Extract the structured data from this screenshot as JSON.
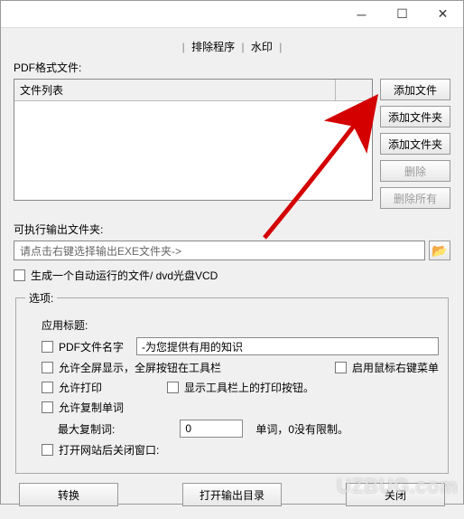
{
  "tabs": {
    "t1": "排除程序",
    "t2": "水印"
  },
  "labels": {
    "pdf_files": "PDF格式文件:",
    "file_list_col": "文件列表",
    "output_folder": "可执行输出文件夹:",
    "output_placeholder": "请点击右键选择输出EXE文件夹->",
    "generate_autorun": "生成一个自动运行的文件/  dvd光盘VCD",
    "options_legend": "选项:",
    "app_title_label": "应用标题:",
    "pdf_name": "PDF文件名字",
    "pdf_name_value": "-为您提供有用的知识",
    "allow_fullscreen": "允许全屏显示，全屏按钮在工具栏",
    "enable_rightclick": "启用鼠标右键菜单",
    "allow_print": "允许打印",
    "show_print_button": "显示工具栏上的打印按钮。",
    "allow_copy_word": "允许复制单词",
    "max_copy_label": "最大复制词:",
    "max_copy_value": "0",
    "max_copy_suffix": "单词，0没有限制。",
    "close_after_nav": "打开网站后关闭窗口:"
  },
  "side_buttons": {
    "add_file": "添加文件",
    "add_folder": "添加文件夹",
    "add_folder2": "添加文件夹",
    "delete": "删除",
    "delete_all": "删除所有"
  },
  "bottom_buttons": {
    "convert": "转换",
    "open_output": "打开输出目录",
    "close": "关闭"
  },
  "watermark": "UZBUG.com"
}
